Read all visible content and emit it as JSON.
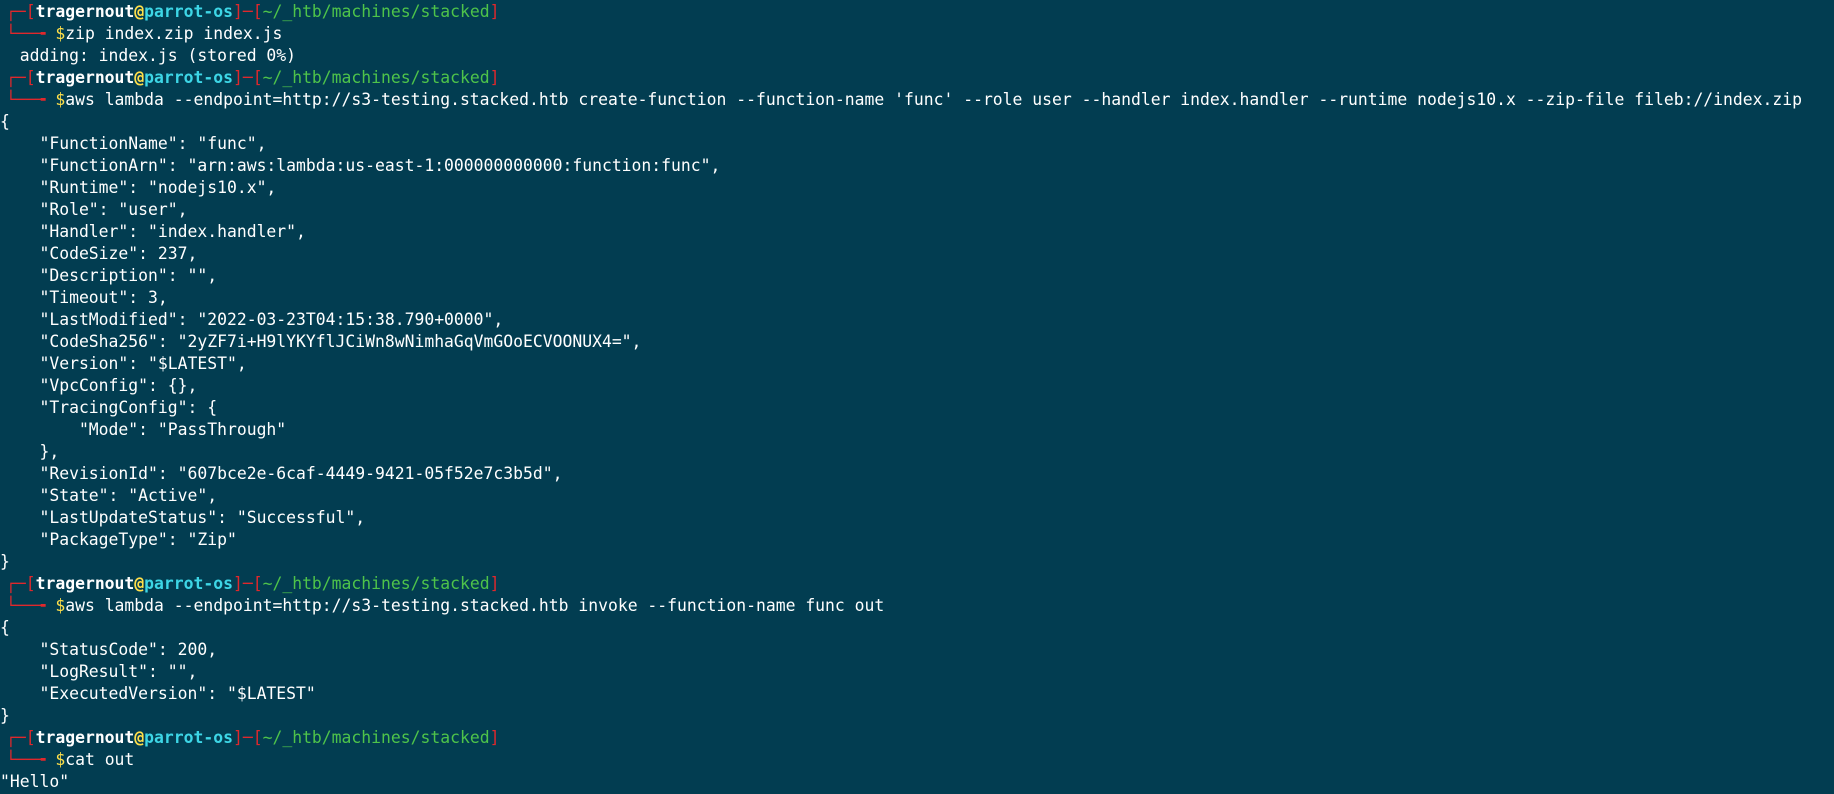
{
  "prompt": {
    "user": "tragernout",
    "at": "@",
    "host": "parrot-os",
    "cwd": "~/_htb/machines/stacked",
    "dollar": "$",
    "top_left": "┌─[",
    "mid": "]─[",
    "end": "]",
    "bottom": "└──╼ "
  },
  "blocks": [
    {
      "command": "zip index.zip index.js",
      "output": [
        "  adding: index.js (stored 0%)"
      ]
    },
    {
      "command": "aws lambda --endpoint=http://s3-testing.stacked.htb create-function --function-name 'func' --role user --handler index.handler --runtime nodejs10.x --zip-file fileb://index.zip",
      "output": [
        "{",
        "    \"FunctionName\": \"func\",",
        "    \"FunctionArn\": \"arn:aws:lambda:us-east-1:000000000000:function:func\",",
        "    \"Runtime\": \"nodejs10.x\",",
        "    \"Role\": \"user\",",
        "    \"Handler\": \"index.handler\",",
        "    \"CodeSize\": 237,",
        "    \"Description\": \"\",",
        "    \"Timeout\": 3,",
        "    \"LastModified\": \"2022-03-23T04:15:38.790+0000\",",
        "    \"CodeSha256\": \"2yZF7i+H9lYKYflJCiWn8wNimhaGqVmGOoECVOONUX4=\",",
        "    \"Version\": \"$LATEST\",",
        "    \"VpcConfig\": {},",
        "    \"TracingConfig\": {",
        "        \"Mode\": \"PassThrough\"",
        "    },",
        "    \"RevisionId\": \"607bce2e-6caf-4449-9421-05f52e7c3b5d\",",
        "    \"State\": \"Active\",",
        "    \"LastUpdateStatus\": \"Successful\",",
        "    \"PackageType\": \"Zip\"",
        "}"
      ]
    },
    {
      "command": "aws lambda --endpoint=http://s3-testing.stacked.htb invoke --function-name func out",
      "output": [
        "{",
        "    \"StatusCode\": 200,",
        "    \"LogResult\": \"\",",
        "    \"ExecutedVersion\": \"$LATEST\"",
        "}"
      ]
    },
    {
      "command": "cat out",
      "output": [
        "\"Hello\""
      ]
    }
  ]
}
